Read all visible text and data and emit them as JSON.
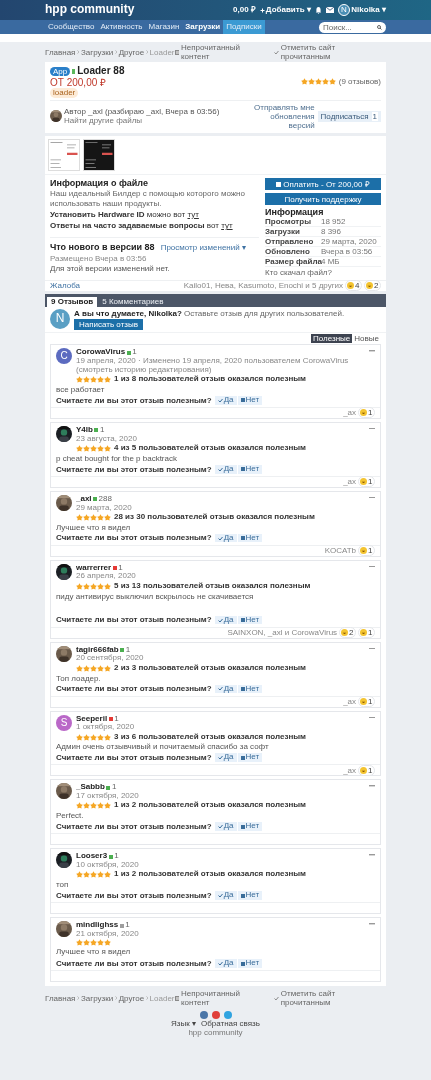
{
  "header": {
    "logo": "hpp community",
    "balance": "0,00 ₽",
    "add": "Добавить ▾",
    "user": {
      "initial": "N",
      "name": "Nikolka ▾"
    }
  },
  "nav": {
    "items": [
      {
        "label": "Сообщество",
        "selected": false,
        "highlighted": false
      },
      {
        "label": "Активность",
        "selected": false,
        "highlighted": false
      },
      {
        "label": "Магазин",
        "selected": false,
        "highlighted": false
      },
      {
        "label": "Загрузки",
        "selected": true,
        "highlighted": false
      },
      {
        "label": "Подписки",
        "selected": false,
        "highlighted": true
      }
    ],
    "search": {
      "placeholder": "Поиск..."
    }
  },
  "breadcrumbs": [
    {
      "items": [
        "Главная",
        "Загрузки",
        "Другое",
        "Loader"
      ],
      "actions": [
        "Непрочитанный контент",
        "Отметить сайт прочитанным"
      ]
    },
    {
      "items": [
        "Главная",
        "Загрузки",
        "Другое",
        "Loader"
      ],
      "actions": [
        "Непрочитанный контент",
        "Отметить сайт прочитанным"
      ]
    }
  ],
  "file": {
    "badge": "App",
    "title": "Loader 88",
    "price": "ОТ 200,00 ₽",
    "tag": "loader",
    "stars": 5,
    "reviews_count": "(9 отзывов)",
    "author": "Автор _axl (разбираю _axl, Вчера в 03:56)",
    "find_more": "Найти другие файлы",
    "notify": "Отправлять мне обновления версий",
    "follow": "Подписаться",
    "follow_count": "1"
  },
  "details": {
    "info_title": "Информация о файле",
    "description": "Наш идеальный Билдер с помощью которого можно использовать наши продукты.",
    "lines": [
      {
        "label": "Установить Hardware ID",
        "text": "можно вот",
        "link": "тут"
      },
      {
        "label": "Ответы на часто задаваемые вопросы",
        "text": "вот",
        "link": "тут"
      }
    ],
    "whats_new": "Что нового в версии 88",
    "changes": "Просмотр изменений ▾",
    "posted": "Размещено Вчера в 03:56",
    "changelog": "Для этой версии изменений нет.",
    "buy": "Оплатить - От 200,00 ₽",
    "support": "Получить поддержку",
    "info_heading": "Информация",
    "stats": [
      {
        "label": "Просмотры",
        "value": "18 952"
      },
      {
        "label": "Загрузки",
        "value": "8 396"
      },
      {
        "label": "Отправлено",
        "value": "29 марта, 2020"
      },
      {
        "label": "Обновлено",
        "value": "Вчера в 03:56"
      },
      {
        "label": "Размер файла",
        "value": "4 МБ"
      }
    ],
    "who": "Кто скачал файл?",
    "report": "Жалоба",
    "reacted": "Kailo01, Нева, Kasumoto, Enochi и 5 других",
    "reactions": [
      "4",
      "2"
    ]
  },
  "tabs": [
    {
      "label": "9 Отзывов",
      "selected": true
    },
    {
      "label": "5 Комментариев",
      "selected": false
    }
  ],
  "prompt": {
    "initial": "N",
    "text": "**А вы что думаете, Nikolka?** Оставьте отзыв для других пользователей.",
    "button": "Написать отзыв"
  },
  "sort": [
    {
      "label": "Полезные",
      "selected": true
    },
    {
      "label": "Новые",
      "selected": false
    }
  ],
  "reviews": [
    {
      "avatar": {
        "kind": "letter",
        "letter": "C",
        "color": "#5c6bc0"
      },
      "name": "CorowaVirus",
      "rep": {
        "text": "1",
        "color": "#4caf50"
      },
      "date": "19 апреля, 2020 · Изменено 19 апреля, 2020 пользователем CorowaVirus (смотреть историю редактирования)",
      "stars": 5,
      "helpful": "1 из 8 пользователей отзыв оказался полезным",
      "text": "все работает",
      "question": "Считаете ли вы этот отзыв полезным?",
      "yes": "Да",
      "no": "Нет",
      "reactors": "_ax",
      "reactions": [
        "1"
      ],
      "tall": false
    },
    {
      "avatar": {
        "kind": "picture"
      },
      "name": "Y4lb",
      "rep": {
        "text": "1",
        "color": "#4caf50"
      },
      "date": "23 августа, 2020",
      "stars": 5,
      "helpful": "4 из 5 пользователей отзыв оказался полезным",
      "text": "p cheat bought for the p backtrack",
      "question": "Считаете ли вы этот отзыв полезным?",
      "yes": "Да",
      "no": "Нет",
      "reactors": "_ax",
      "reactions": [
        "1"
      ],
      "tall": false
    },
    {
      "avatar": {
        "kind": "picture"
      },
      "name": "_axl",
      "rep": {
        "text": "288",
        "color": "#4caf50"
      },
      "date": "29 марта, 2020",
      "stars": 5,
      "helpful": "28 из 30 пользователей отзыв оказался полезным",
      "text": "Лучшее что я видел",
      "question": "Считаете ли вы этот отзыв полезным?",
      "yes": "Да",
      "no": "Нет",
      "reactors": "KOCATb",
      "reactions": [
        "1"
      ],
      "tall": false
    },
    {
      "avatar": {
        "kind": "picture"
      },
      "name": "warrerrer",
      "rep": {
        "text": "1",
        "color": "#e53935"
      },
      "date": "26 апреля, 2020",
      "stars": 5,
      "helpful": "5 из 13 пользователей отзыв оказался полезным",
      "text": "пиду антивирус выключил вскрылось не скачивается",
      "question": "Считаете ли вы этот отзыв полезным?",
      "yes": "Да",
      "no": "Нет",
      "reactors": "SAINXON, _axl и CorowaVirus",
      "reactions": [
        "2",
        "1"
      ],
      "tall": true
    },
    {
      "avatar": {
        "kind": "picture"
      },
      "name": "tagir666fab",
      "rep": {
        "text": "1",
        "color": "#4caf50"
      },
      "date": "20 сентября, 2020",
      "stars": 5,
      "helpful": "2 из 3 пользователей отзыв оказался полезным",
      "text": "Топ лоадер.",
      "question": "Считаете ли вы этот отзыв полезным?",
      "yes": "Да",
      "no": "Нет",
      "reactors": "_ax",
      "reactions": [
        "1"
      ],
      "tall": false
    },
    {
      "avatar": {
        "kind": "letter",
        "letter": "S",
        "color": "#ba68c8"
      },
      "name": "Seeperil",
      "rep": {
        "text": "1",
        "color": "#e53935"
      },
      "date": "1 октября, 2020",
      "stars": 5,
      "helpful": "3 из 6 пользователей отзыв оказался полезным",
      "text": "Админ очень отзывчивый и почитаемый спасибо за софт",
      "question": "Считаете ли вы этот отзыв полезным?",
      "yes": "Да",
      "no": "Нет",
      "reactors": "_ax",
      "reactions": [
        "1"
      ],
      "tall": false
    },
    {
      "avatar": {
        "kind": "picture"
      },
      "name": "_Sabbb",
      "rep": {
        "text": "1",
        "color": "#4caf50"
      },
      "date": "17 октября, 2020",
      "stars": 5,
      "helpful": "1 из 2 пользователей отзыв оказался полезным",
      "text": "Perfect.",
      "question": "Считаете ли вы этот отзыв полезным?",
      "yes": "Да",
      "no": "Нет",
      "tall": false
    },
    {
      "avatar": {
        "kind": "picture"
      },
      "name": "Looser3",
      "rep": {
        "text": "1",
        "color": "#4caf50"
      },
      "date": "10 октября, 2020",
      "stars": 5,
      "helpful": "1 из 2 пользователей отзыв оказался полезным",
      "text": "топ",
      "question": "Считаете ли вы этот отзыв полезным?",
      "yes": "Да",
      "no": "Нет",
      "tall": false
    },
    {
      "avatar": {
        "kind": "picture"
      },
      "name": "mindlighss",
      "rep": {
        "text": "1",
        "color": "#9e9e9e"
      },
      "date": "21 октября, 2020",
      "stars": 5,
      "text": "Лучшее что я видел",
      "question": "Считаете ли вы этот отзыв полезным?",
      "yes": "Да",
      "no": "Нет",
      "tall": false
    }
  ],
  "footer": {
    "links": [
      "Язык ▾",
      "Обратная связь"
    ],
    "copyright": "hpp community"
  }
}
